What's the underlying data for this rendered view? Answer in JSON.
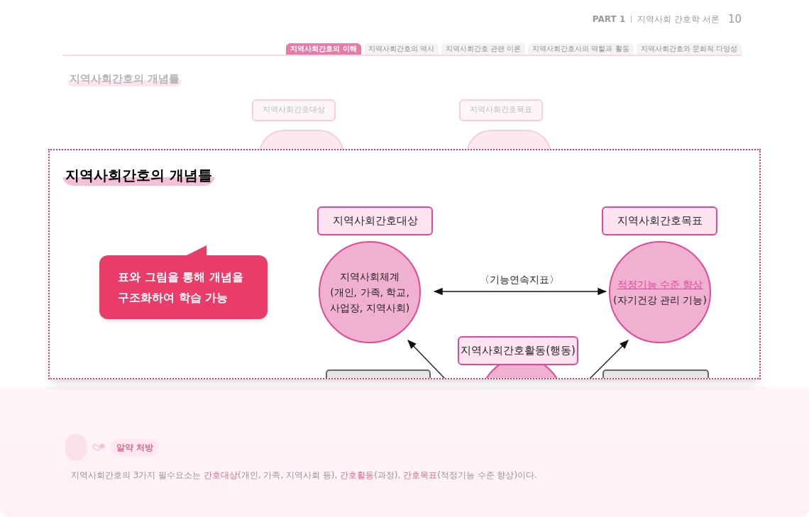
{
  "header": {
    "part": "PART 1",
    "chapter": "지역사회 간호학 서론",
    "page": "10"
  },
  "tabs": [
    {
      "label": "지역사회간호의 이해",
      "selected": true
    },
    {
      "label": "지역사회간호의 역사",
      "selected": false
    },
    {
      "label": "지역사회간호 관련 이론",
      "selected": false
    },
    {
      "label": "지역사회간호사의 역할과 활동",
      "selected": false
    },
    {
      "label": "지역사회간호와 문화적 다양성",
      "selected": false
    }
  ],
  "background_section": {
    "title": "지역사회간호의 개념틀",
    "boxes": [
      "지역사회간호대상",
      "지역사회간호목표"
    ]
  },
  "zoom_panel": {
    "title": "지역사회간호의 개념틀",
    "callout": [
      "표와 그림을 통해 개념을",
      "구조화하여 학습 가능"
    ],
    "diagram": {
      "target_box": "지역사회간호대상",
      "target_circle": [
        "지역사회체계",
        "(개인, 가족, 학교,",
        "사업장, 지역사회)"
      ],
      "goal_box": "지역사회간호목표",
      "goal_circle": [
        {
          "text": "적정기능 수준 향상",
          "kind": "emphasis"
        },
        {
          "text": "(자기건강 관리 기능)",
          "kind": "plain"
        }
      ],
      "link_label": "〈기능연속지표〉",
      "activity_box": "지역사회간호활동(행동)"
    }
  },
  "tip": {
    "label": "알약 처방",
    "segments": [
      {
        "text": "지역사회간호의 3가지 필수요소는 ",
        "kind": "plain"
      },
      {
        "text": "간호대상",
        "kind": "highlight"
      },
      {
        "text": "(개인, 가족, 지역사회 등), ",
        "kind": "plain"
      },
      {
        "text": "간호활동",
        "kind": "highlight"
      },
      {
        "text": "(과정), ",
        "kind": "plain"
      },
      {
        "text": "간호목표",
        "kind": "highlight"
      },
      {
        "text": "(적정기능 수준 향상)이다.",
        "kind": "plain"
      }
    ]
  }
}
